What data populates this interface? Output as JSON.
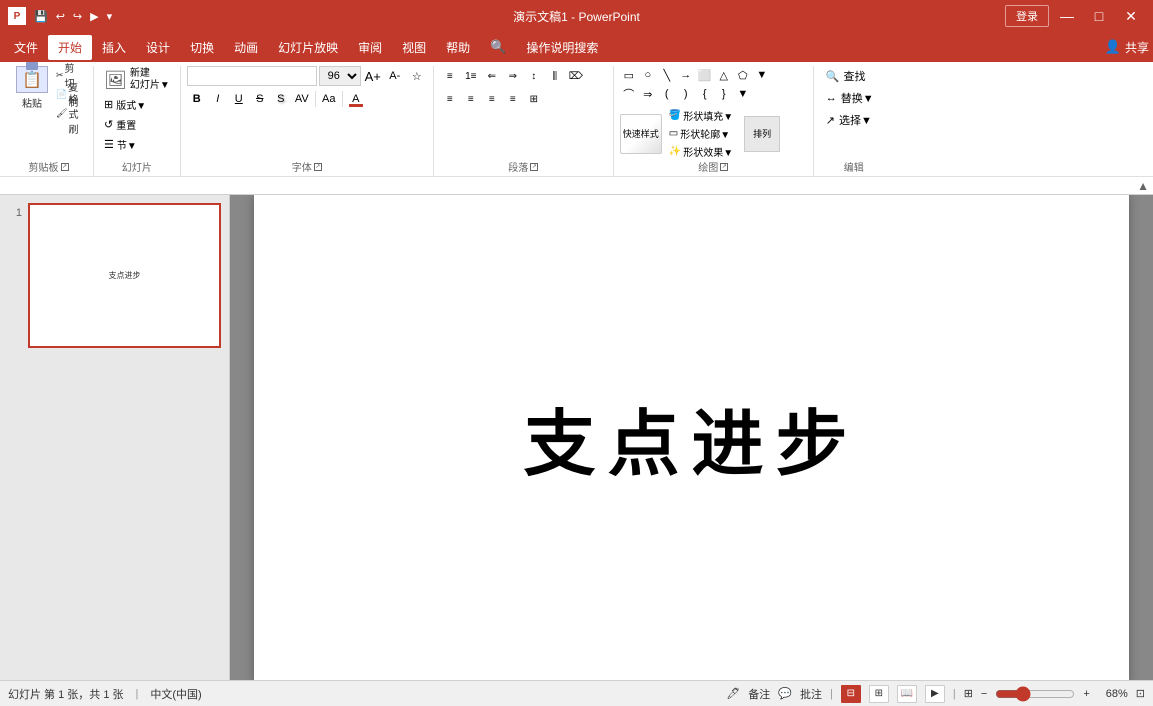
{
  "titlebar": {
    "title": "演示文稿1 - PowerPoint",
    "login_label": "登录",
    "quick_access": [
      "💾",
      "↩",
      "↪",
      "▶",
      "▼"
    ],
    "win_btns": [
      "—",
      "□",
      "✕"
    ]
  },
  "menubar": {
    "items": [
      "文件",
      "开始",
      "插入",
      "设计",
      "切换",
      "动画",
      "幻灯片放映",
      "审阅",
      "视图",
      "帮助",
      "🔍",
      "操作说明搜索"
    ],
    "active_item": "开始",
    "right_items": [
      "共享"
    ]
  },
  "ribbon": {
    "groups": [
      {
        "label": "剪贴板",
        "expand": true
      },
      {
        "label": "幻灯片",
        "expand": false
      },
      {
        "label": "字体",
        "expand": true
      },
      {
        "label": "段落",
        "expand": true
      },
      {
        "label": "绘图",
        "expand": true
      },
      {
        "label": "编辑",
        "expand": false
      }
    ],
    "paste_label": "粘贴",
    "new_slide_label": "新建\n幻灯片▼",
    "layout_label": "版式▼",
    "reset_label": "重置",
    "section_label": "节▼",
    "font_name": "",
    "font_size": "96",
    "find_label": "查找",
    "replace_label": "替换▼",
    "select_label": "选择▼",
    "arrange_label": "排列",
    "quick_style_label": "快速样式",
    "shape_fill_label": "形状填充▼",
    "shape_outline_label": "形状轮廓▼",
    "shape_effect_label": "形状效果▼"
  },
  "canvas": {
    "slide_text": "支点进步",
    "slide_number": "1"
  },
  "statusbar": {
    "slide_info": "幻灯片 第 1 张，共 1 张",
    "language": "中文(中国)",
    "notes_label": "备注",
    "comments_label": "批注",
    "zoom_level": "68%"
  },
  "thumbnail": {
    "text": "支点进步"
  }
}
